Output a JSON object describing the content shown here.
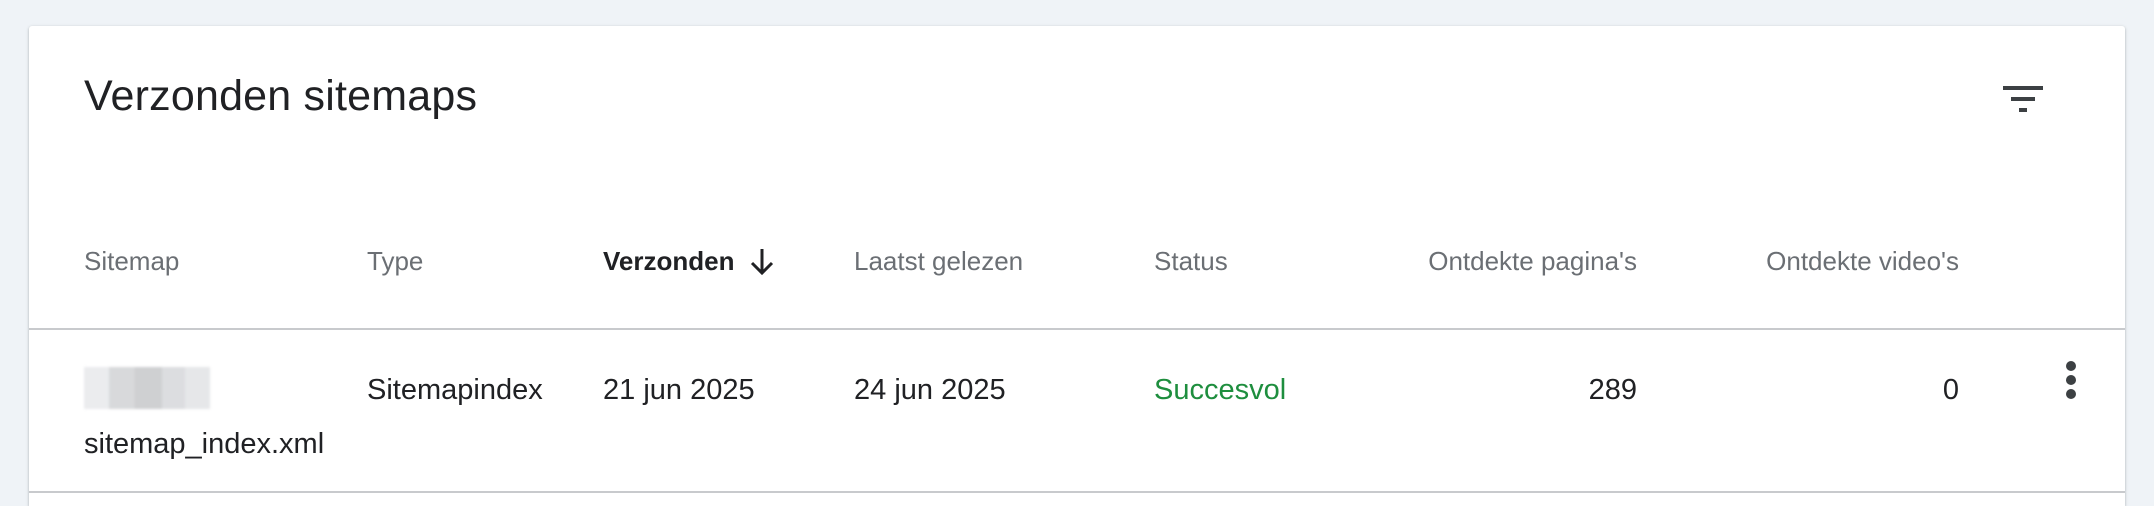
{
  "title": "Verzonden sitemaps",
  "icons": {
    "filter": "filter-list-icon",
    "sort": "arrow-down-icon",
    "more": "more-vert-icon"
  },
  "columns": {
    "sitemap": "Sitemap",
    "type": "Type",
    "submitted": "Verzonden",
    "last_read": "Laatst gelezen",
    "status": "Status",
    "pages": "Ontdekte pagina's",
    "videos": "Ontdekte video's"
  },
  "rows": [
    {
      "sitemap": "sitemap_index.xml",
      "type": "Sitemapindex",
      "submitted": "21 jun 2025",
      "last_read": "24 jun 2025",
      "status": "Succesvol",
      "pages": "289",
      "videos": "0"
    }
  ],
  "colors": {
    "status_success": "#1e8e3e",
    "background": "#eff3f7",
    "text_primary": "#202124",
    "text_secondary": "#6b6f74"
  }
}
